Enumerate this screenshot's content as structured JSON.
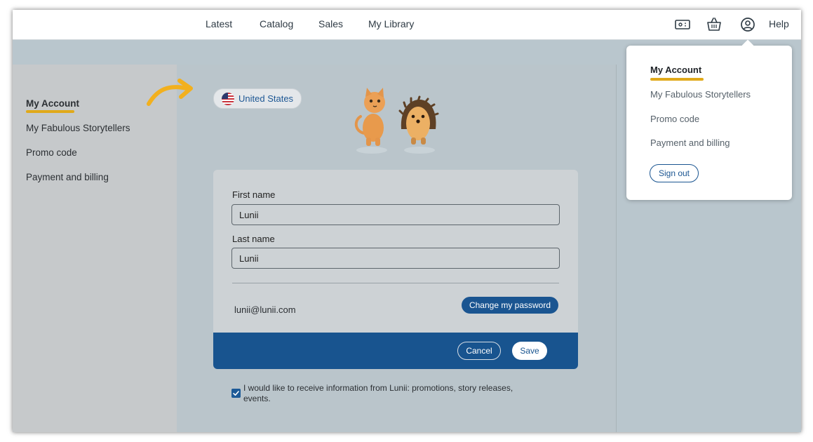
{
  "nav": {
    "items": [
      {
        "label": "Latest"
      },
      {
        "label": "Catalog"
      },
      {
        "label": "Sales"
      },
      {
        "label": "My Library"
      }
    ],
    "help_label": "Help"
  },
  "sidebar": {
    "items": [
      {
        "label": "My Account",
        "active": true
      },
      {
        "label": "My Fabulous Storytellers"
      },
      {
        "label": "Promo code"
      },
      {
        "label": "Payment and billing"
      }
    ]
  },
  "country": {
    "label": "United States",
    "icon": "us-flag-icon"
  },
  "form": {
    "first_name_label": "First name",
    "first_name_value": "Lunii",
    "last_name_label": "Last name",
    "last_name_value": "Lunii",
    "email": "lunii@lunii.com",
    "change_password_label": "Change my password",
    "cancel_label": "Cancel",
    "save_label": "Save"
  },
  "newsletter": {
    "label": "I would like to receive information from Lunii: promotions, story releases, events.",
    "checked": true
  },
  "dropdown": {
    "items": [
      {
        "label": "My Account",
        "active": true
      },
      {
        "label": "My Fabulous Storytellers"
      },
      {
        "label": "Promo code"
      },
      {
        "label": "Payment and billing"
      }
    ],
    "sign_out_label": "Sign out"
  },
  "colors": {
    "accent_yellow": "#e0a91a",
    "brand_blue": "#18548f",
    "page_background": "#b9c6cd"
  }
}
